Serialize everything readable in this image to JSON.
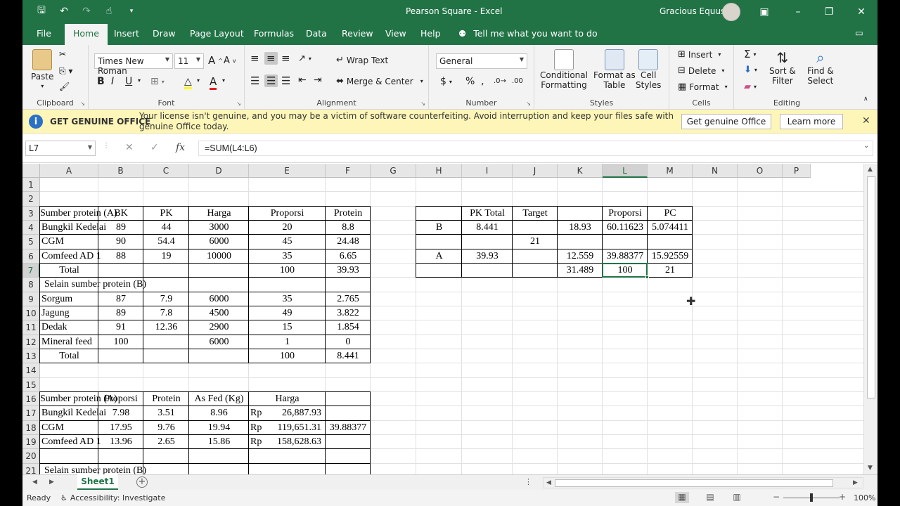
{
  "window": {
    "title": "Pearson Square  -  Excel",
    "user": "Gracious Equus"
  },
  "tabs": [
    "File",
    "Home",
    "Insert",
    "Draw",
    "Page Layout",
    "Formulas",
    "Data",
    "Review",
    "View",
    "Help"
  ],
  "tell_me": "Tell me what you want to do",
  "ribbon": {
    "clipboard": {
      "paste": "Paste",
      "label": "Clipboard"
    },
    "font": {
      "name": "Times New Roman",
      "size": "11",
      "label": "Font"
    },
    "alignment": {
      "wrap": "Wrap Text",
      "merge": "Merge & Center",
      "label": "Alignment"
    },
    "number": {
      "format": "General",
      "label": "Number"
    },
    "styles": {
      "cond1": "Conditional",
      "cond2": "Formatting",
      "fmt1": "Format as",
      "fmt2": "Table",
      "cell1": "Cell",
      "cell2": "Styles",
      "label": "Styles"
    },
    "cells": {
      "insert": "Insert",
      "delete": "Delete",
      "format": "Format",
      "label": "Cells"
    },
    "editing": {
      "sort1": "Sort &",
      "sort2": "Filter",
      "find1": "Find &",
      "find2": "Select",
      "label": "Editing"
    }
  },
  "message": {
    "title": "GET GENUINE OFFICE",
    "text": "Your license isn't genuine, and you may be a victim of software counterfeiting. Avoid interruption and keep your files safe with genuine Office today.",
    "btn_genuine": "Get genuine Office",
    "btn_learn": "Learn more"
  },
  "formula_bar": {
    "name_box": "L7",
    "formula": "=SUM(L4:L6)"
  },
  "columns": [
    "A",
    "B",
    "C",
    "D",
    "E",
    "F",
    "G",
    "H",
    "I",
    "J",
    "K",
    "L",
    "M",
    "N",
    "O",
    "P"
  ],
  "rows": [
    "1",
    "2",
    "3",
    "4",
    "5",
    "6",
    "7",
    "8",
    "9",
    "10",
    "11",
    "12",
    "13",
    "14",
    "15",
    "16",
    "17",
    "18",
    "19",
    "20",
    "21"
  ],
  "cells": {
    "A3": "Sumber protein (A)",
    "B3": "BK",
    "C3": "PK",
    "D3": "Harga",
    "E3": "Proporsi",
    "F3": "Protein",
    "A4": "Bungkil Kedelai",
    "B4": "89",
    "C4": "44",
    "D4": "3000",
    "E4": "20",
    "F4": "8.8",
    "A5": "CGM",
    "B5": "90",
    "C5": "54.4",
    "D5": "6000",
    "E5": "45",
    "F5": "24.48",
    "A6": "Comfeed AD 1",
    "B6": "88",
    "C6": "19",
    "D6": "10000",
    "E6": "35",
    "F6": "6.65",
    "A7": "Total",
    "E7": "100",
    "F7": "39.93",
    "A8": "Selain sumber protein (B)",
    "A9": "Sorgum",
    "B9": "87",
    "C9": "7.9",
    "D9": "6000",
    "E9": "35",
    "F9": "2.765",
    "A10": "Jagung",
    "B10": "89",
    "C10": "7.8",
    "D10": "4500",
    "E10": "49",
    "F10": "3.822",
    "A11": "Dedak",
    "B11": "91",
    "C11": "12.36",
    "D11": "2900",
    "E11": "15",
    "F11": "1.854",
    "A12": "Mineral feed",
    "B12": "100",
    "D12": "6000",
    "E12": "1",
    "F12": "0",
    "A13": "Total",
    "E13": "100",
    "F13": "8.441",
    "A16": "Sumber protein (A)",
    "B16": "Proporsi",
    "C16": "Protein",
    "D16": "As Fed (Kg)",
    "E16": "Harga",
    "A17": "Bungkil Kedelai",
    "B17": "7.98",
    "C17": "3.51",
    "D17": "8.96",
    "E17rp": "Rp",
    "E17": "26,887.93",
    "A18": "CGM",
    "B18": "17.95",
    "C18": "9.76",
    "D18": "19.94",
    "E18rp": "Rp",
    "E18": "119,651.31",
    "F18": "39.88377",
    "A19": "Comfeed AD 1",
    "B19": "13.96",
    "C19": "2.65",
    "D19": "15.86",
    "E19rp": "Rp",
    "E19": "158,628.63",
    "A21": "Selain sumber protein (B)",
    "I3": "PK Total",
    "J3": "Target",
    "L3": "Proporsi",
    "M3": "PC",
    "H4": "B",
    "I4": "8.441",
    "K4": "18.93",
    "L4": "60.11623",
    "M4": "5.074411",
    "J5": "21",
    "H6": "A",
    "I6": "39.93",
    "K6": "12.559",
    "L6": "39.88377",
    "M6": "15.92559",
    "K7": "31.489",
    "L7": "100",
    "M7": "21"
  },
  "sheet": {
    "name": "Sheet1"
  },
  "status": {
    "ready": "Ready",
    "accessibility": "Accessibility: Investigate",
    "zoom": "100%"
  },
  "colors": {
    "accent": "#217346",
    "message_bg": "#fdf6b8"
  }
}
